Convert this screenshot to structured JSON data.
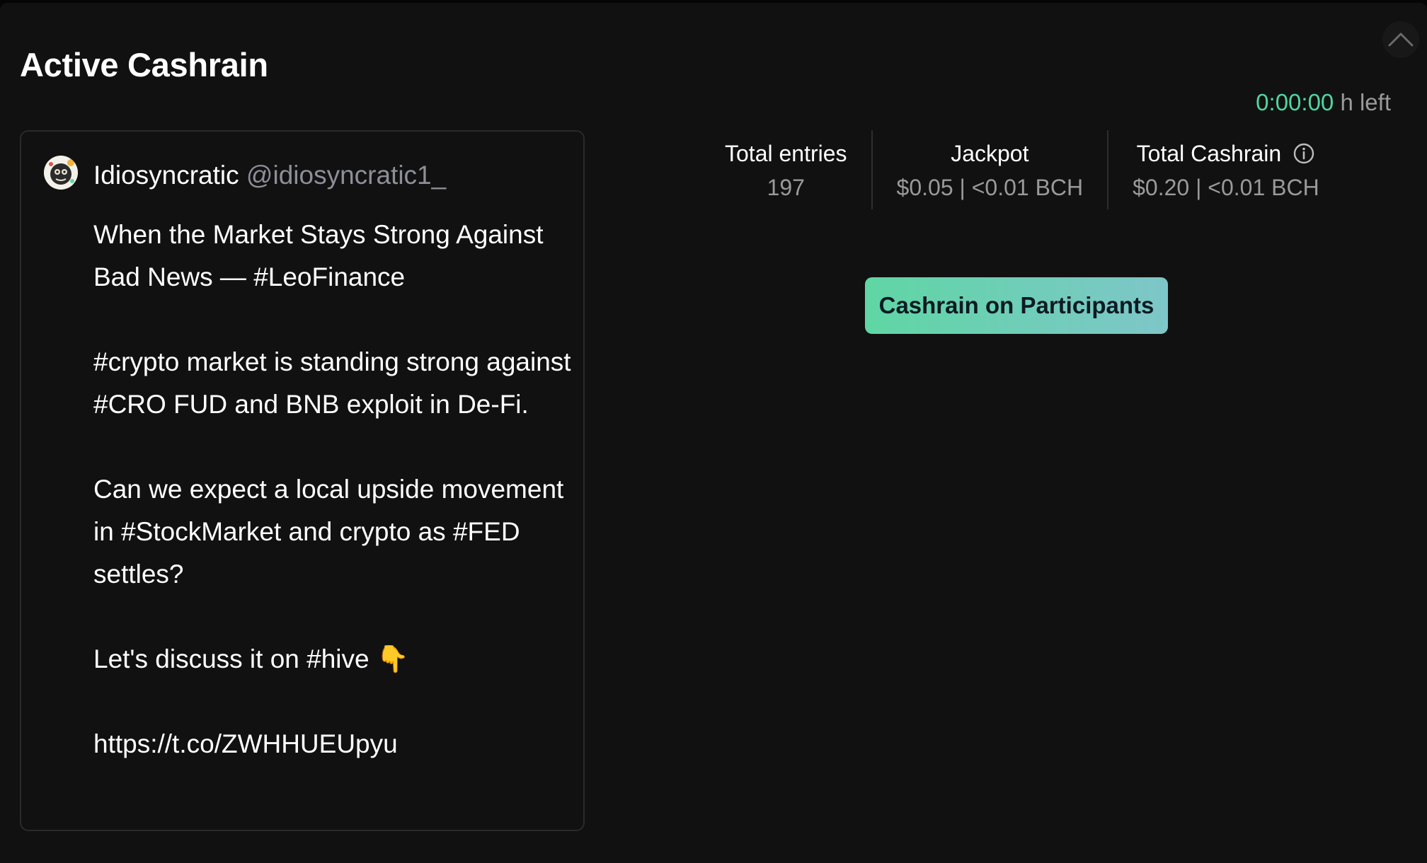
{
  "header": {
    "title": "Active Cashrain",
    "collapse_icon": "chevron-up-icon"
  },
  "timer": {
    "value": "0:00:00",
    "unit": "h left",
    "color": "#4fd6a2"
  },
  "tweet": {
    "author_name": "Idiosyncratic",
    "author_handle": "@idiosyncratic1_",
    "paragraphs": [
      "When the Market Stays Strong Against Bad News — #LeoFinance",
      "#crypto market is standing strong against #CRO FUD and BNB exploit in De-Fi.",
      "Can we expect a local upside movement in #StockMarket and crypto as #FED settles?",
      "Let's discuss it on #hive 👇",
      "https://t.co/ZWHHUEUpyu"
    ]
  },
  "stats": [
    {
      "label": "Total entries",
      "value": "197"
    },
    {
      "label": "Jackpot",
      "value": "$0.05 | <0.01 BCH"
    },
    {
      "label": "Total Cashrain",
      "value": "$0.20 | <0.01 BCH",
      "icon": "info-icon"
    }
  ],
  "actions": {
    "cashrain_button_label": "Cashrain on Participants",
    "accent_gradient": [
      "#5fd6a4",
      "#7ec6c9"
    ]
  }
}
